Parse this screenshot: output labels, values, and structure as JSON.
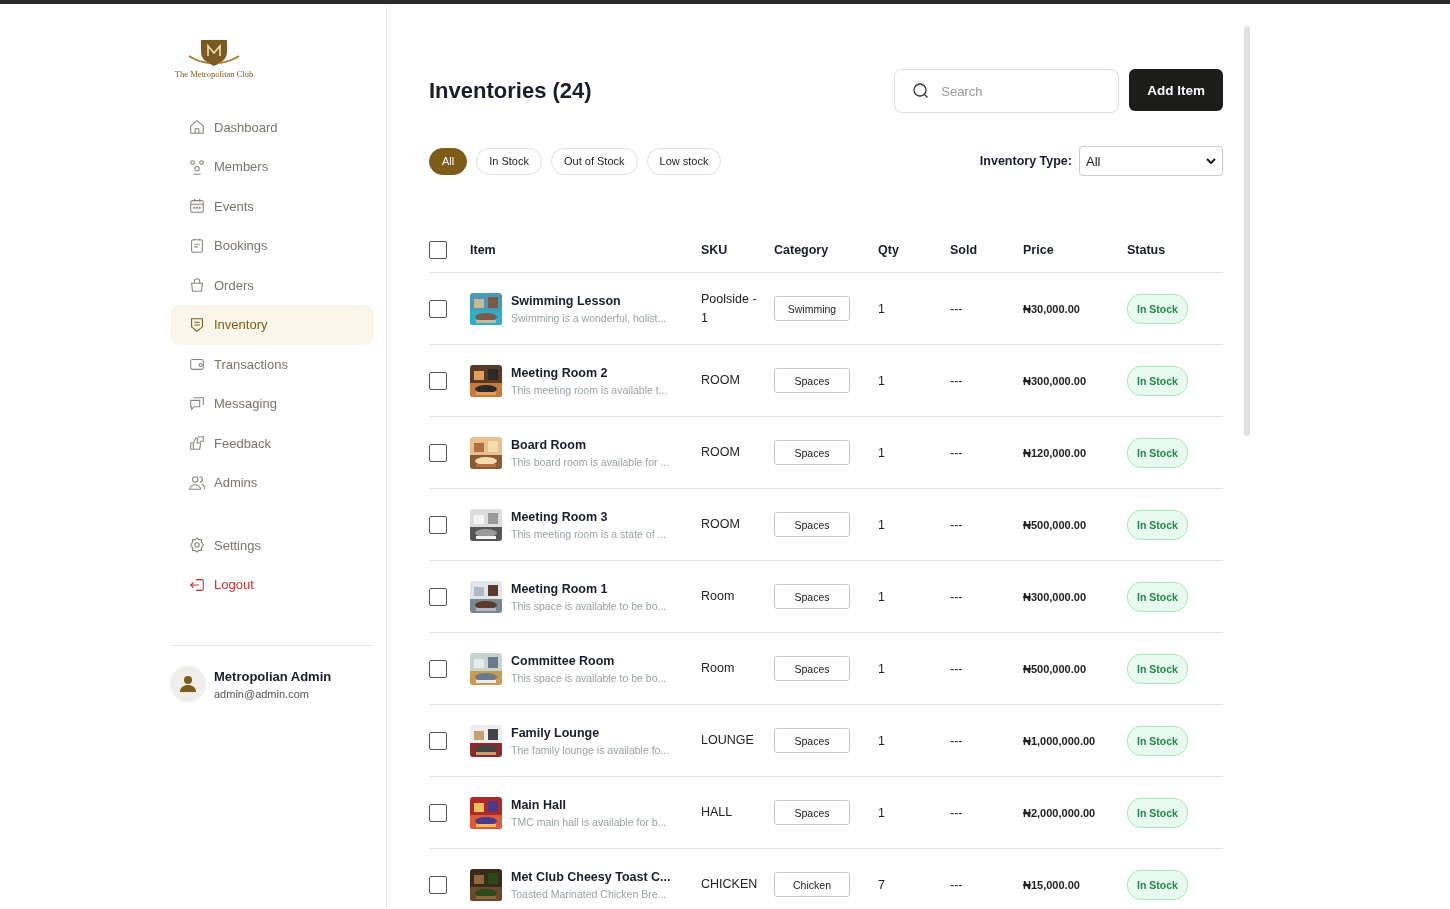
{
  "brand": {
    "name": "The Metropolitan Club"
  },
  "sidebar": {
    "items": [
      {
        "label": "Dashboard",
        "kind": "link",
        "selected": false
      },
      {
        "label": "Members",
        "kind": "link",
        "selected": false
      },
      {
        "label": "Events",
        "kind": "link",
        "selected": false
      },
      {
        "label": "Bookings",
        "kind": "link",
        "selected": false
      },
      {
        "label": "Orders",
        "kind": "link",
        "selected": false
      },
      {
        "label": "Inventory",
        "kind": "link",
        "selected": true
      },
      {
        "label": "Transactions",
        "kind": "link",
        "selected": false
      },
      {
        "label": "Messaging",
        "kind": "link",
        "selected": false
      },
      {
        "label": "Feedback",
        "kind": "link",
        "selected": false
      },
      {
        "label": "Admins",
        "kind": "link",
        "selected": false
      }
    ],
    "bottom_items": [
      {
        "label": "Settings",
        "kind": "link",
        "selected": false
      },
      {
        "label": "Logout",
        "kind": "danger",
        "selected": false
      }
    ],
    "user": {
      "name": "Metropolian Admin",
      "email": "admin@admin.com"
    }
  },
  "header": {
    "title": "Inventories (24)",
    "search": {
      "placeholder": "Search"
    },
    "add_button": "Add Item"
  },
  "filters": [
    {
      "label": "All",
      "selected": true
    },
    {
      "label": "In Stock",
      "selected": false
    },
    {
      "label": "Out of Stock",
      "selected": false
    },
    {
      "label": "Low stock",
      "selected": false
    }
  ],
  "type_filter": {
    "label": "Inventory Type:",
    "value": "All"
  },
  "table": {
    "select_all": {
      "checked": false
    },
    "columns": [
      "Item",
      "SKU",
      "Category",
      "Qty",
      "Sold",
      "Price",
      "Status"
    ],
    "rows": [
      {
        "checked": false,
        "name": "Swimming Lesson",
        "description": "Swimming is a wonderful, holist...",
        "sku": "Poolside - 1",
        "category": "Swimming",
        "qty": "1",
        "sold": "---",
        "price": "₦30,000.00",
        "status": "In Stock"
      },
      {
        "checked": false,
        "name": "Meeting Room 2",
        "description": "This meeting room is available t...",
        "sku": "ROOM",
        "category": "Spaces",
        "qty": "1",
        "sold": "---",
        "price": "₦300,000.00",
        "status": "In Stock"
      },
      {
        "checked": false,
        "name": "Board Room",
        "description": "This board room is available for ...",
        "sku": "ROOM",
        "category": "Spaces",
        "qty": "1",
        "sold": "---",
        "price": "₦120,000.00",
        "status": "In Stock"
      },
      {
        "checked": false,
        "name": "Meeting Room 3",
        "description": "This meeting room is a state of ...",
        "sku": "ROOM",
        "category": "Spaces",
        "qty": "1",
        "sold": "---",
        "price": "₦500,000.00",
        "status": "In Stock"
      },
      {
        "checked": false,
        "name": "Meeting Room 1",
        "description": "This space is available to be bo...",
        "sku": "Room",
        "category": "Spaces",
        "qty": "1",
        "sold": "---",
        "price": "₦300,000.00",
        "status": "In Stock"
      },
      {
        "checked": false,
        "name": "Committee Room",
        "description": "This space is available to be bo...",
        "sku": "Room",
        "category": "Spaces",
        "qty": "1",
        "sold": "---",
        "price": "₦500,000.00",
        "status": "In Stock"
      },
      {
        "checked": false,
        "name": "Family Lounge",
        "description": "The family lounge is available fo...",
        "sku": "LOUNGE",
        "category": "Spaces",
        "qty": "1",
        "sold": "---",
        "price": "₦1,000,000.00",
        "status": "In Stock"
      },
      {
        "checked": false,
        "name": "Main Hall",
        "description": "TMC main hall is available for b...",
        "sku": "HALL",
        "category": "Spaces",
        "qty": "1",
        "sold": "---",
        "price": "₦2,000,000.00",
        "status": "In Stock"
      },
      {
        "checked": false,
        "name": "Met Club Cheesy Toast C...",
        "description": "Toasted Marinated Chicken Bre...",
        "sku": "CHICKEN",
        "category": "Chicken",
        "qty": "7",
        "sold": "---",
        "price": "₦15,000.00",
        "status": "In Stock"
      }
    ]
  }
}
